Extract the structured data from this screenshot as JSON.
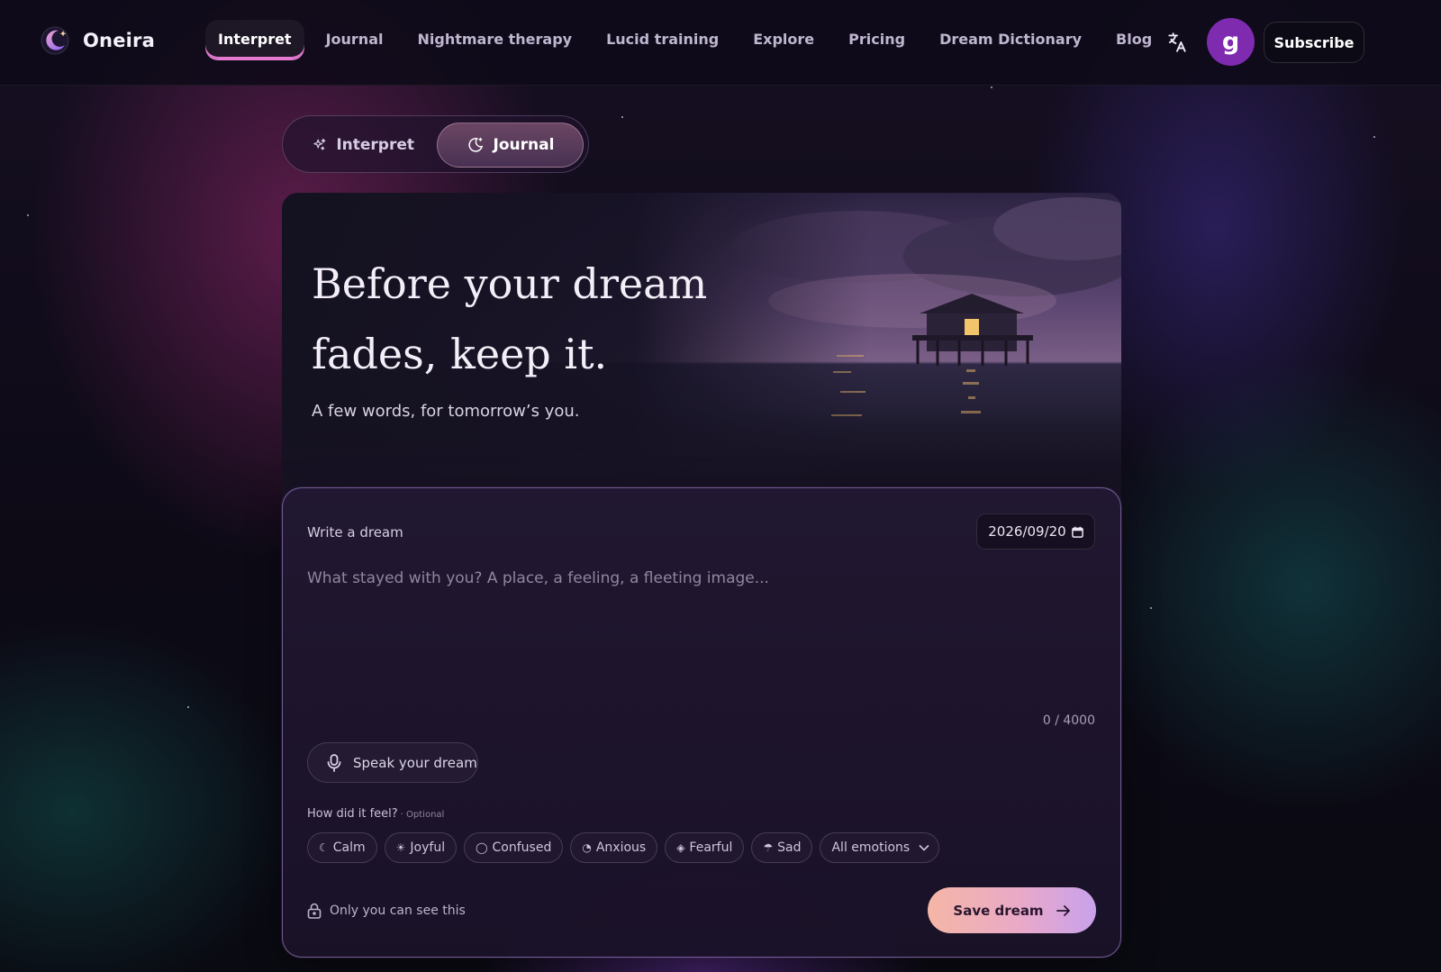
{
  "app": {
    "name": "Oneira"
  },
  "nav": {
    "items": [
      {
        "label": "Interpret",
        "active": true
      },
      {
        "label": "Journal"
      },
      {
        "label": "Nightmare therapy"
      },
      {
        "label": "Lucid training"
      },
      {
        "label": "Explore"
      },
      {
        "label": "Pricing"
      },
      {
        "label": "Dream Dictionary"
      },
      {
        "label": "Blog"
      }
    ],
    "translate_icon": "translate-icon",
    "avatar_initial": "g",
    "subscribe_label": "Subscribe"
  },
  "mode_toggle": {
    "interpret_label": "Interpret",
    "journal_label": "Journal",
    "selected": "Journal"
  },
  "hero": {
    "title_line1": "Before your dream",
    "title_line2": "fades, keep it.",
    "subtitle": "A few words, for tomorrow’s you."
  },
  "form": {
    "label": "Write a dream",
    "date": "2026/09/20",
    "placeholder": "What stayed with you? A place, a feeling, a fleeting image...",
    "value": "",
    "char_count": "0 / 4000",
    "speak_label": "Speak your dream",
    "feel_label": "How did it feel?",
    "feel_optional": "· Optional",
    "emotions": [
      {
        "label": "Calm",
        "icon": "☾"
      },
      {
        "label": "Joyful",
        "icon": "☀"
      },
      {
        "label": "Confused",
        "icon": "◯"
      },
      {
        "label": "Anxious",
        "icon": "◔"
      },
      {
        "label": "Fearful",
        "icon": "◈"
      },
      {
        "label": "Sad",
        "icon": "☂"
      }
    ],
    "all_emotions_label": "All emotions",
    "privacy_label": "Only you can see this",
    "save_label": "Save dream"
  },
  "colors": {
    "accent_pink": "#e27ad0",
    "avatar_bg": "#7e2bb0",
    "save_gradient_start": "#f5b6a6",
    "save_gradient_end": "#c9a1ec"
  }
}
